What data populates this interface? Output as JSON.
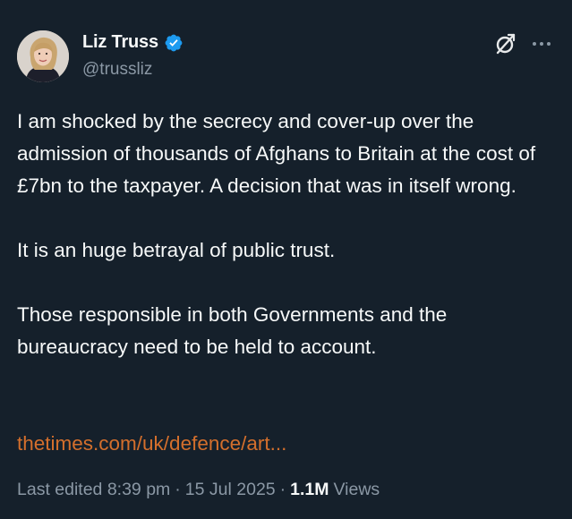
{
  "author": {
    "display_name": "Liz Truss",
    "handle": "@trussliz",
    "verified": true
  },
  "icons": {
    "verified": "verified-badge-icon",
    "grok": "grok-icon",
    "more": "more-options-icon"
  },
  "colors": {
    "background": "#15202b",
    "text": "#f7f9f9",
    "muted": "#8b98a5",
    "link": "#d46f2c",
    "verified": "#1d9bf0"
  },
  "tweet": {
    "paragraphs": [
      "I am shocked by the secrecy and cover-up over the admission of thousands of Afghans to Britain at the cost of £7bn to the taxpayer. A decision that was in itself wrong.",
      "It is an huge betrayal of public trust.",
      "Those responsible in both Governments and the bureaucracy need to be held to account."
    ],
    "link_text": "thetimes.com/uk/defence/art..."
  },
  "meta": {
    "edited_label": "Last edited 8:39 pm",
    "separator": "·",
    "date": "15 Jul 2025",
    "views_count": "1.1M",
    "views_label": "Views"
  }
}
